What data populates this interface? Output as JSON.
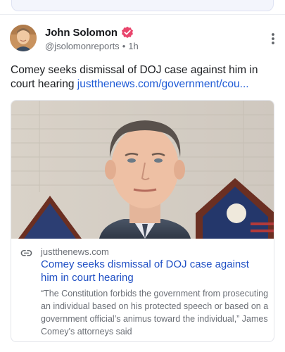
{
  "post": {
    "author": {
      "name": "John Solomon",
      "handle": "@jsolomonreports",
      "separator": "•",
      "time": "1h",
      "verified_color": "#e9456c"
    },
    "text": "Comey seeks dismissal of DOJ case against him in court hearing ",
    "link_text": "justthenews.com/government/cou...",
    "link_color": "#1f5bd6"
  },
  "card": {
    "domain": "justthenews.com",
    "title": "Comey seeks dismissal of DOJ case against him in court hearing",
    "description": "“The Constitution forbids the government from prosecuting an individual based on his protected speech or based on a government official’s animus toward the individual,” James Comey's attorneys said",
    "title_color": "#1f4fc4"
  },
  "icons": {
    "verified": "verified-badge-icon",
    "more": "more-options-icon",
    "link": "link-icon"
  }
}
